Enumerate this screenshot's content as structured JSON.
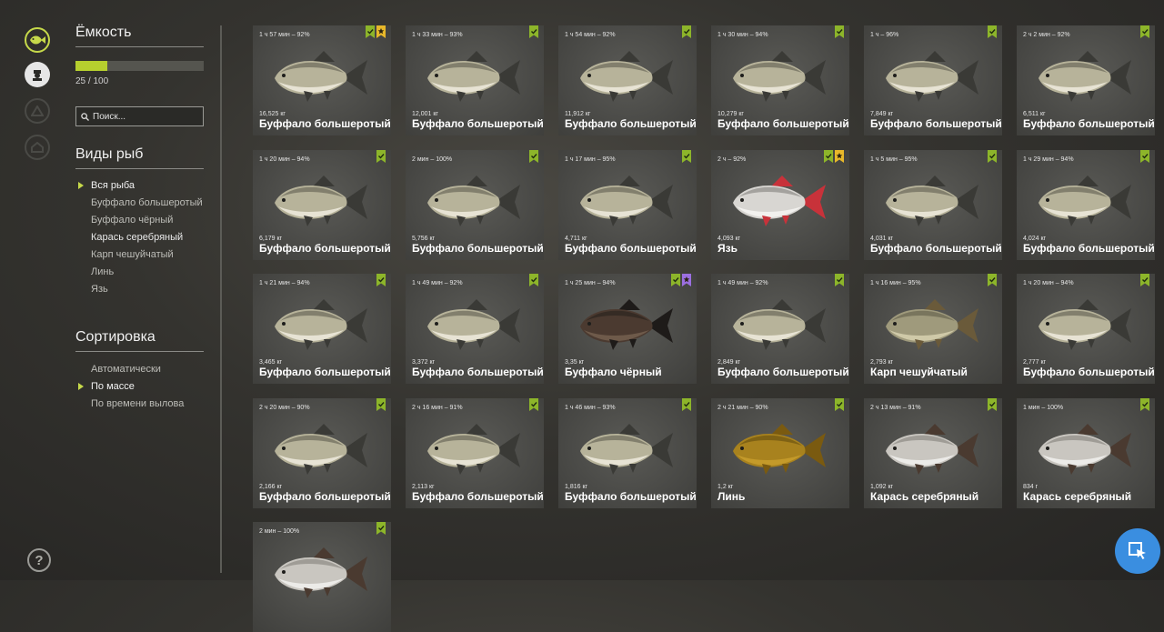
{
  "sidebar": {
    "capacity_title": "Ёмкость",
    "capacity_text": "25 / 100",
    "capacity_fraction": 0.25,
    "search_placeholder": "Поиск...",
    "species_title": "Виды рыб",
    "species": [
      {
        "label": "Вся рыба",
        "selected": true
      },
      {
        "label": "Буффало большеротый",
        "selected": false
      },
      {
        "label": "Буффало чёрный",
        "selected": false
      },
      {
        "label": "Карась серебряный",
        "selected": false
      },
      {
        "label": "Карп чешуйчатый",
        "selected": false
      },
      {
        "label": "Линь",
        "selected": false
      },
      {
        "label": "Язь",
        "selected": false
      }
    ],
    "sort_title": "Сортировка",
    "sort_options": [
      {
        "label": "Автоматически",
        "selected": false
      },
      {
        "label": "По массе",
        "selected": true
      },
      {
        "label": "По времени вылова",
        "selected": false
      }
    ],
    "help_label": "?"
  },
  "colors": {
    "accent": "#c6d94a",
    "badge_green": "#8db52a",
    "badge_gold": "#e8b82a",
    "badge_purple": "#9b6fe0"
  },
  "icons": [
    "fish-icon",
    "fisherman-icon",
    "tent-icon",
    "house-icon",
    "help-icon",
    "search-icon",
    "pointer-icon"
  ],
  "fish": [
    {
      "time": "1 ч 57 мин – 92%",
      "weight": "16,525 кг",
      "name": "Буффало большеротый",
      "kind": "buffalo",
      "badges": [
        "green",
        "gold"
      ]
    },
    {
      "time": "1 ч 33 мин – 93%",
      "weight": "12,001 кг",
      "name": "Буффало большеротый",
      "kind": "buffalo",
      "badges": [
        "green"
      ]
    },
    {
      "time": "1 ч 54 мин – 92%",
      "weight": "11,912 кг",
      "name": "Буффало большеротый",
      "kind": "buffalo",
      "badges": [
        "green"
      ]
    },
    {
      "time": "1 ч 30 мин – 94%",
      "weight": "10,279 кг",
      "name": "Буффало большеротый",
      "kind": "buffalo",
      "badges": [
        "green"
      ]
    },
    {
      "time": "1 ч – 96%",
      "weight": "7,849 кг",
      "name": "Буффало большеротый",
      "kind": "buffalo",
      "badges": [
        "green"
      ]
    },
    {
      "time": "2 ч 2 мин – 92%",
      "weight": "6,511 кг",
      "name": "Буффало большеротый",
      "kind": "buffalo",
      "badges": [
        "green"
      ]
    },
    {
      "time": "1 ч 20 мин – 94%",
      "weight": "6,179 кг",
      "name": "Буффало большеротый",
      "kind": "buffalo",
      "badges": [
        "green"
      ]
    },
    {
      "time": "2 мин – 100%",
      "weight": "5,756 кг",
      "name": "Буффало большеротый",
      "kind": "buffalo",
      "badges": [
        "green"
      ]
    },
    {
      "time": "1 ч 17 мин – 95%",
      "weight": "4,711 кг",
      "name": "Буффало большеротый",
      "kind": "buffalo",
      "badges": [
        "green"
      ]
    },
    {
      "time": "2 ч – 92%",
      "weight": "4,093 кг",
      "name": "Язь",
      "kind": "ide",
      "badges": [
        "green",
        "gold"
      ]
    },
    {
      "time": "1 ч 5 мин – 95%",
      "weight": "4,031 кг",
      "name": "Буффало большеротый",
      "kind": "buffalo",
      "badges": [
        "green"
      ]
    },
    {
      "time": "1 ч 29 мин – 94%",
      "weight": "4,024 кг",
      "name": "Буффало большеротый",
      "kind": "buffalo",
      "badges": [
        "green"
      ]
    },
    {
      "time": "1 ч 21 мин – 94%",
      "weight": "3,465 кг",
      "name": "Буффало большеротый",
      "kind": "buffalo",
      "badges": [
        "green"
      ]
    },
    {
      "time": "1 ч 49 мин – 92%",
      "weight": "3,372 кг",
      "name": "Буффало большеротый",
      "kind": "buffalo",
      "badges": [
        "green"
      ]
    },
    {
      "time": "1 ч 25 мин – 94%",
      "weight": "3,35 кг",
      "name": "Буффало чёрный",
      "kind": "black",
      "badges": [
        "green",
        "purple"
      ]
    },
    {
      "time": "1 ч 49 мин – 92%",
      "weight": "2,849 кг",
      "name": "Буффало большеротый",
      "kind": "buffalo",
      "badges": [
        "green"
      ]
    },
    {
      "time": "1 ч 16 мин – 95%",
      "weight": "2,793 кг",
      "name": "Карп чешуйчатый",
      "kind": "carp",
      "badges": [
        "green"
      ]
    },
    {
      "time": "1 ч 20 мин – 94%",
      "weight": "2,777 кг",
      "name": "Буффало большеротый",
      "kind": "buffalo",
      "badges": [
        "green"
      ]
    },
    {
      "time": "2 ч 20 мин – 90%",
      "weight": "2,166 кг",
      "name": "Буффало большеротый",
      "kind": "buffalo",
      "badges": [
        "green"
      ]
    },
    {
      "time": "2 ч 16 мин – 91%",
      "weight": "2,113 кг",
      "name": "Буффало большеротый",
      "kind": "buffalo",
      "badges": [
        "green"
      ]
    },
    {
      "time": "1 ч 46 мин – 93%",
      "weight": "1,816 кг",
      "name": "Буффало большеротый",
      "kind": "buffalo",
      "badges": [
        "green"
      ]
    },
    {
      "time": "2 ч 21 мин – 90%",
      "weight": "1,2 кг",
      "name": "Линь",
      "kind": "tench",
      "badges": [
        "green"
      ]
    },
    {
      "time": "2 ч 13 мин – 91%",
      "weight": "1,092 кг",
      "name": "Карась серебряный",
      "kind": "crucian",
      "badges": [
        "green"
      ]
    },
    {
      "time": "1 мин – 100%",
      "weight": "834 г",
      "name": "Карась серебряный",
      "kind": "crucian",
      "badges": [
        "green"
      ]
    },
    {
      "time": "2 мин – 100%",
      "weight": "",
      "name": "",
      "kind": "crucian",
      "badges": [
        "green"
      ]
    }
  ]
}
